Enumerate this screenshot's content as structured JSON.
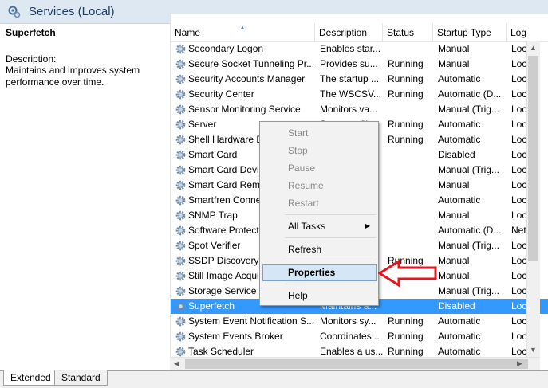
{
  "header": {
    "title": "Services (Local)"
  },
  "left_pane": {
    "service_name": "Superfetch",
    "description_label": "Description:",
    "description_text": "Maintains and improves system performance over time."
  },
  "columns": [
    "Name",
    "Description",
    "Status",
    "Startup Type",
    "Log"
  ],
  "rows": [
    {
      "name": "Secondary Logon",
      "desc": "Enables star...",
      "status": "",
      "startup": "Manual",
      "log": "Loc"
    },
    {
      "name": "Secure Socket Tunneling Pr...",
      "desc": "Provides su...",
      "status": "Running",
      "startup": "Manual",
      "log": "Loc"
    },
    {
      "name": "Security Accounts Manager",
      "desc": "The startup ...",
      "status": "Running",
      "startup": "Automatic",
      "log": "Loc"
    },
    {
      "name": "Security Center",
      "desc": "The WSCSV...",
      "status": "Running",
      "startup": "Automatic (D...",
      "log": "Loc"
    },
    {
      "name": "Sensor Monitoring Service",
      "desc": "Monitors va...",
      "status": "",
      "startup": "Manual (Trig...",
      "log": "Loc"
    },
    {
      "name": "Server",
      "desc": "Supports fil...",
      "status": "Running",
      "startup": "Automatic",
      "log": "Loc"
    },
    {
      "name": "Shell Hardware D",
      "desc": "",
      "status": "Running",
      "startup": "Automatic",
      "log": "Loc"
    },
    {
      "name": "Smart Card",
      "desc": "",
      "status": "",
      "startup": "Disabled",
      "log": "Loc"
    },
    {
      "name": "Smart Card Devic",
      "desc": "",
      "status": "",
      "startup": "Manual (Trig...",
      "log": "Loc"
    },
    {
      "name": "Smart Card Remo",
      "desc": "",
      "status": "",
      "startup": "Manual",
      "log": "Loc"
    },
    {
      "name": "Smartfren Conne",
      "desc": "",
      "status": "",
      "startup": "Automatic",
      "log": "Loc"
    },
    {
      "name": "SNMP Trap",
      "desc": "",
      "status": "",
      "startup": "Manual",
      "log": "Loc"
    },
    {
      "name": "Software Protecti",
      "desc": "",
      "status": "",
      "startup": "Automatic (D...",
      "log": "Net"
    },
    {
      "name": "Spot Verifier",
      "desc": "",
      "status": "",
      "startup": "Manual (Trig...",
      "log": "Loc"
    },
    {
      "name": "SSDP Discovery",
      "desc": "",
      "status": "Running",
      "startup": "Manual",
      "log": "Loc"
    },
    {
      "name": "Still Image Acqui",
      "desc": "",
      "status": "",
      "startup": "Manual",
      "log": "Loc"
    },
    {
      "name": "Storage Service",
      "desc": "",
      "status": "",
      "startup": "Manual (Trig...",
      "log": "Loc"
    },
    {
      "name": "Superfetch",
      "desc": "Maintains a...",
      "status": "",
      "startup": "Disabled",
      "log": "Loc",
      "selected": true
    },
    {
      "name": "System Event Notification S...",
      "desc": "Monitors sy...",
      "status": "Running",
      "startup": "Automatic",
      "log": "Loc"
    },
    {
      "name": "System Events Broker",
      "desc": "Coordinates...",
      "status": "Running",
      "startup": "Automatic",
      "log": "Loc"
    },
    {
      "name": "Task Scheduler",
      "desc": "Enables a us...",
      "status": "Running",
      "startup": "Automatic",
      "log": "Loc"
    }
  ],
  "context_menu": {
    "start": "Start",
    "stop": "Stop",
    "pause": "Pause",
    "resume": "Resume",
    "restart": "Restart",
    "all_tasks": "All Tasks",
    "refresh": "Refresh",
    "properties": "Properties",
    "help": "Help"
  },
  "tabs": {
    "extended": "Extended",
    "standard": "Standard"
  },
  "colors": {
    "selection": "#3399ff",
    "menu_highlight": "#d5e6f7",
    "arrow": "#e8141b",
    "header_band": "#dde8f3"
  },
  "icons": {
    "title": "services-gear-icon",
    "row": "gear-icon"
  }
}
